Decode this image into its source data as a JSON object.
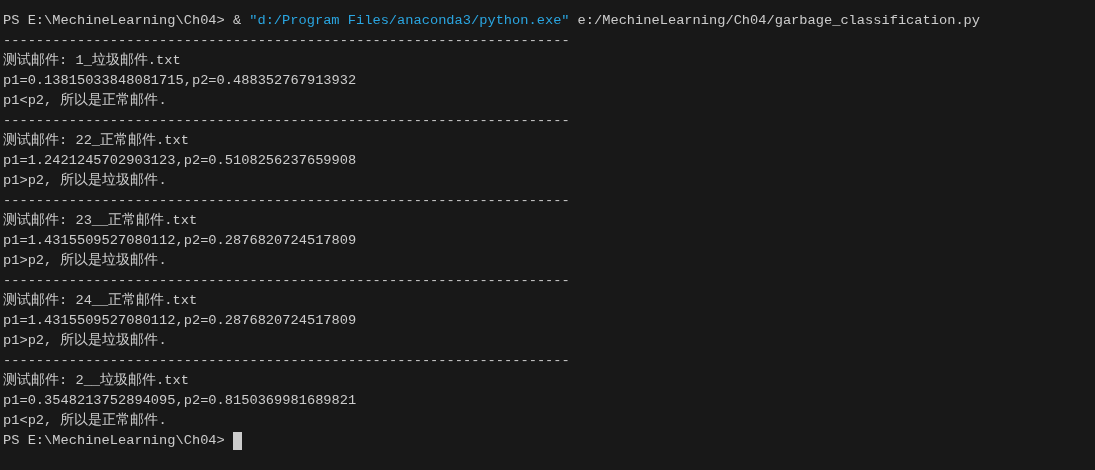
{
  "terminal": {
    "lines": [
      {
        "kind": "command",
        "prompt": "PS E:\\MechineLearning\\Ch04>",
        "operator": "&",
        "executable": "\"d:/Program Files/anaconda3/python.exe\"",
        "argument": "e:/MechineLearning/Ch04/garbage_classification.py"
      },
      {
        "kind": "separator",
        "text": "---------------------------------------------------------------------"
      },
      {
        "kind": "output",
        "text": "测试邮件: 1_垃圾邮件.txt"
      },
      {
        "kind": "output",
        "text": "p1=0.13815033848081715,p2=0.488352767913932"
      },
      {
        "kind": "output",
        "text": "p1<p2, 所以是正常邮件."
      },
      {
        "kind": "separator",
        "text": "---------------------------------------------------------------------"
      },
      {
        "kind": "output",
        "text": "测试邮件: 22_正常邮件.txt"
      },
      {
        "kind": "output",
        "text": "p1=1.2421245702903123,p2=0.5108256237659908"
      },
      {
        "kind": "output",
        "text": "p1>p2, 所以是垃圾邮件."
      },
      {
        "kind": "separator",
        "text": "---------------------------------------------------------------------"
      },
      {
        "kind": "output",
        "text": "测试邮件: 23__正常邮件.txt"
      },
      {
        "kind": "output",
        "text": "p1=1.4315509527080112,p2=0.2876820724517809"
      },
      {
        "kind": "output",
        "text": "p1>p2, 所以是垃圾邮件."
      },
      {
        "kind": "separator",
        "text": "---------------------------------------------------------------------"
      },
      {
        "kind": "output",
        "text": "测试邮件: 24__正常邮件.txt"
      },
      {
        "kind": "output",
        "text": "p1=1.4315509527080112,p2=0.2876820724517809"
      },
      {
        "kind": "output",
        "text": "p1>p2, 所以是垃圾邮件."
      },
      {
        "kind": "separator",
        "text": "---------------------------------------------------------------------"
      },
      {
        "kind": "output",
        "text": "测试邮件: 2__垃圾邮件.txt"
      },
      {
        "kind": "output",
        "text": "p1=0.3548213752894095,p2=0.8150369981689821"
      },
      {
        "kind": "output",
        "text": "p1<p2, 所以是正常邮件."
      },
      {
        "kind": "prompt",
        "prompt": "PS E:\\MechineLearning\\Ch04>",
        "cursor": true
      }
    ]
  }
}
